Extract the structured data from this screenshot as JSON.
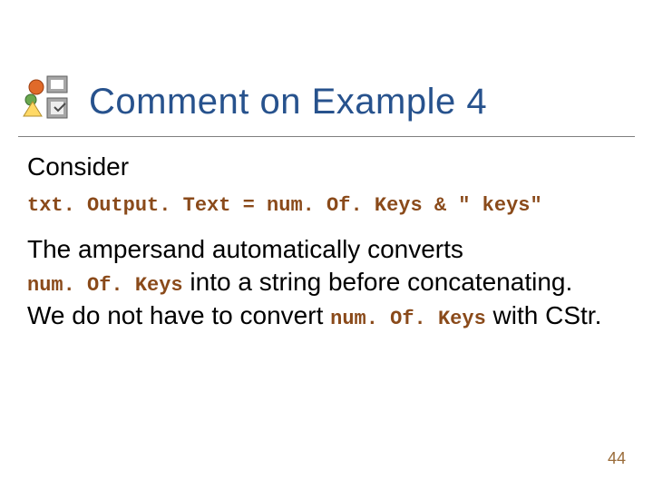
{
  "title": "Comment on Example 4",
  "body": {
    "consider": "Consider",
    "code_line": "txt. Output. Text = num. Of. Keys & \" keys\"",
    "para1": "The ampersand automatically converts",
    "code_var": "num. Of. Keys",
    "para2_rest": " into a string before concatenating.",
    "para3_pre": "We do not have to convert ",
    "para3_post": " with CStr."
  },
  "page_number": "44"
}
